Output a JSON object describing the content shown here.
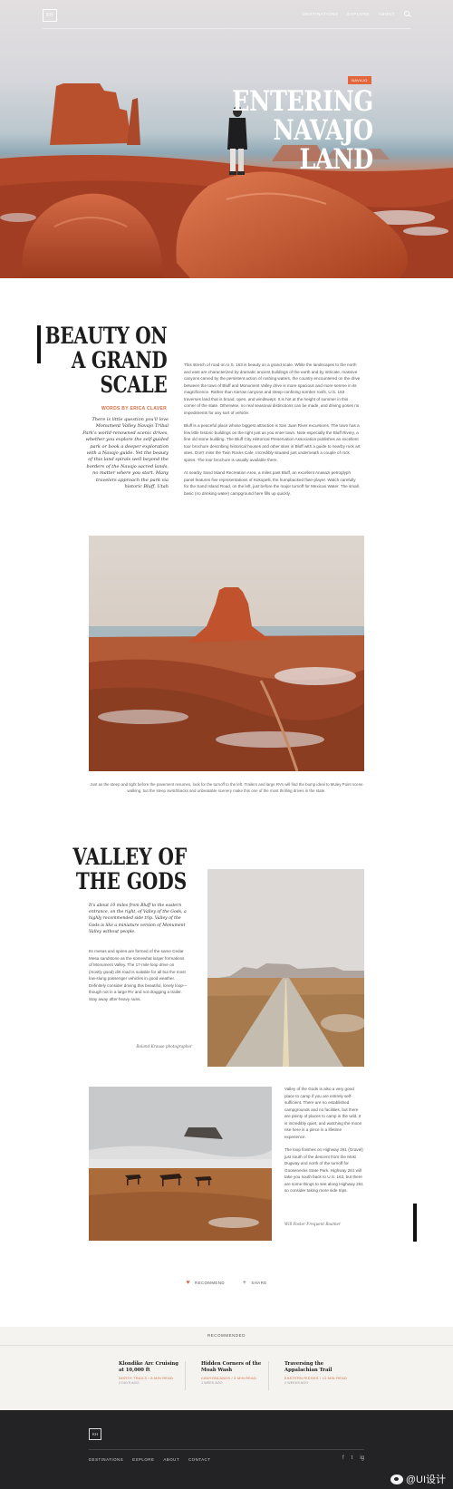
{
  "nav": {
    "logo": "KH",
    "items": [
      "DESTINATIONS",
      "EXPLORE",
      "ABOUT"
    ]
  },
  "hero": {
    "tag": "NAVAJO",
    "title_lines": [
      "ENTERING",
      "NAVAJO",
      "LAND"
    ]
  },
  "section1": {
    "title_lines": [
      "BEAUTY ON",
      "A GRAND",
      "SCALE"
    ],
    "byline": "WORDS BY ERICA CLAVER",
    "lead": "There is little question you'll love Monument Valley Navajo Tribal Park's world-renowned scenic drives, whether you explore the self-guided park or book a deeper exploration with a Navajo guide. Yet the beauty of this land spirals well beyond the borders of the Navajo sacred lands, no matter where you start. Many travelers approach the park via historic Bluff, Utah",
    "paragraphs": [
      "This stretch of road on U.S. 163 is beauty on a grand scale. While the landscapes to the north and east are characterized by dramatic ancient buildings of the earth and by intricate, massive canyons carved by the persistent action of rushing waters, the country encountered on the drive between the town of Bluff and Monument Valley drive is more spacious and more serene in its magnificence. Rather than narrow canyons and steep-confining somber roofs, U.S. 163 traverses land that is broad, open, and windswept. It is hot at the height of summer in this corner of the state. Otherwise, no real seasonal distinctions can be made, and driving poses no impediments for any sort of vehicle.",
      "Bluff is a peaceful place whose biggest attraction is San Juan River excursions. The town has a few little historic buildings on the right just as you enter town. Note especially the Bluff Rivery, a fine old stone building. The Bluff City Historical Preservation Association publishes an excellent tour brochure describing historical houses and other sites in Bluff with a guide to nearby rock art sites. Don't miss the Twin Rocks Cafe. Incredibly situated just underneath a couple of rock spires. The tour brochure is usually available there.",
      "At nearby Sand Island Recreation Area, a miles past Bluff, an excellent Anasazi petroglyph panel features five representations of Kokopelli, the humpbacked flute-player. Watch carefully for the Sand Island Road, on the left, just before the major turnoff for Mexican Water. The small, basic (no drinking water) campground here fills up quickly."
    ],
    "caption": "Just as the steep and tight before the pavement resumes, look for the turnoff to the left. Trailers and large RVs will find the bump ideal to Muley Point scene walking, but the steep switchbacks and unbeatable scenery make this one of the most thrilling drives in the state."
  },
  "section2": {
    "title_lines": [
      "VALLEY OF",
      "THE GODS"
    ],
    "lead": "It's about 10 miles from Bluff to the eastern entrance, on the right, of Valley of the Gods, a highly recommended side trip. Valley of the Gods is like a miniature version of Monument Valley without people.",
    "body": "Its mesas and spires are formed of the same Cedar Mesa sandstone as the somewhat larger formations of Monument Valley. The 17-mile loop drive on (mostly good) dirt road is suitable for all but the most low-slung passenger vehicles in good weather. Definitely consider driving this beautiful, lonely loop—though not in a large RV and not dragging a trailer. Stay away after heavy rains.",
    "photo_credit": "Roland Krause photographer"
  },
  "section3": {
    "paragraphs": [
      "Valley of the Gods is also a very good place to camp if you are entirely self-sufficient. There are no established campgrounds and no facilities, but there are plenty of places to camp in the wild. It is incredibly quiet, and watching the moon rise here is a piece in a lifetime experience.",
      "The loop finishes on Highway 261 (Gravel) just south of the descent from the Moki Dugway and north of the turnoff for Goosenecks State Park. Highway 261 will take you south back to U.S. 163, but there are some things to see along Highway 261 so consider taking more side trips."
    ],
    "photo_credit": "Will Foster Frequent Roamer"
  },
  "actions": {
    "recommend": "RECOMMEND",
    "share": "SHARE"
  },
  "recommended": {
    "label": "RECOMMENDED",
    "items": [
      {
        "title": "Klondike Arc Cruising at 10,000 ft",
        "meta": "NORTH TRAILS / 8 MIN READ",
        "date": "2 DAYS AGO"
      },
      {
        "title": "Hidden Corners of the Moab Wash",
        "meta": "CANYONLANDS / 5 MIN READ",
        "date": "1 WEEK AGO"
      },
      {
        "title": "Traversing the Appalachian Trail",
        "meta": "EASTERN RIDGES / 12 MIN READ",
        "date": "2 WEEKS AGO"
      }
    ]
  },
  "footer": {
    "logo": "KH",
    "nav": [
      "DESTINATIONS",
      "EXPLORE",
      "ABOUT",
      "CONTACT"
    ],
    "social": [
      "f",
      "t",
      "ig"
    ]
  },
  "watermark": "@UI设计",
  "colors": {
    "accent": "#e2673d",
    "footer_bg": "#232325",
    "reco_bg": "#f4f3f0"
  }
}
